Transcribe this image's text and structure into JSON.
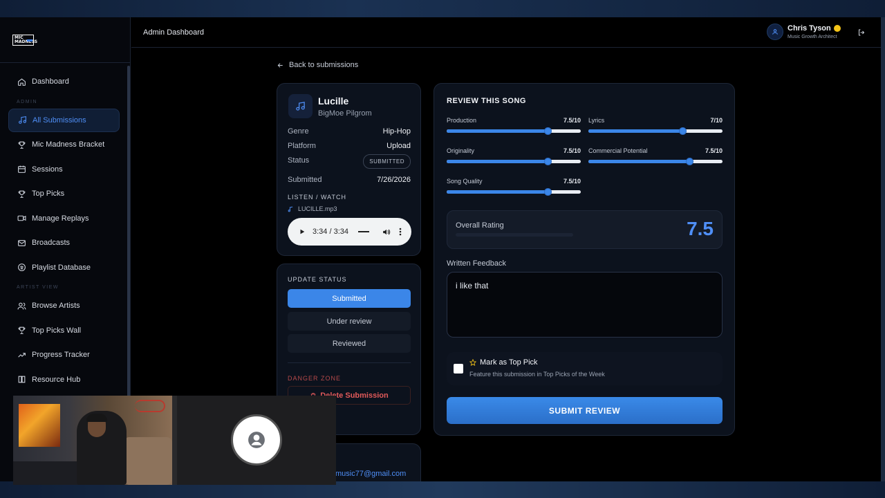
{
  "header": {
    "title": "Admin Dashboard",
    "user_name": "Chris Tyson",
    "user_role": "Music Growth Architect"
  },
  "logo": {
    "line1": "MIC",
    "line2": "MADNESS"
  },
  "sidebar": {
    "admin_label": "ADMIN",
    "artist_label": "ARTIST VIEW",
    "items": [
      {
        "label": "Dashboard",
        "icon": "home-icon"
      },
      {
        "label": "All Submissions",
        "icon": "music-note-icon",
        "active": true
      },
      {
        "label": "Mic Madness Bracket",
        "icon": "trophy-icon"
      },
      {
        "label": "Sessions",
        "icon": "calendar-icon"
      },
      {
        "label": "Top Picks",
        "icon": "trophy-icon"
      },
      {
        "label": "Manage Replays",
        "icon": "video-icon"
      },
      {
        "label": "Broadcasts",
        "icon": "mail-icon"
      },
      {
        "label": "Playlist Database",
        "icon": "spotify-icon"
      },
      {
        "label": "Browse Artists",
        "icon": "users-icon"
      },
      {
        "label": "Top Picks Wall",
        "icon": "trophy-icon"
      },
      {
        "label": "Progress Tracker",
        "icon": "trend-icon"
      },
      {
        "label": "Resource Hub",
        "icon": "book-icon"
      }
    ]
  },
  "back_link": "Back to submissions",
  "song": {
    "title": "Lucille",
    "artist": "BigMoe Pilgrom",
    "genre_label": "Genre",
    "genre": "Hip-Hop",
    "platform_label": "Platform",
    "platform": "Upload",
    "status_label": "Status",
    "status": "SUBMITTED",
    "submitted_label": "Submitted",
    "submitted": "7/26/2026",
    "listen_label": "LISTEN / WATCH",
    "file_name": "LUCILLE.mp3",
    "audio_time": "3:34 / 3:34"
  },
  "update_status": {
    "label": "UPDATE STATUS",
    "options": [
      "Submitted",
      "Under review",
      "Reviewed"
    ],
    "selected": "Submitted",
    "danger_label": "DANGER ZONE",
    "delete_label": "Delete Submission"
  },
  "contact": {
    "email": "music77@gmail.com"
  },
  "review": {
    "title": "REVIEW THIS SONG",
    "criteria": [
      {
        "label": "Production",
        "value": "7.5/10",
        "level": 0.75
      },
      {
        "label": "Lyrics",
        "value": "7/10",
        "level": 0.7
      },
      {
        "label": "Originality",
        "value": "7.5/10",
        "level": 0.75
      },
      {
        "label": "Commercial Potential",
        "value": "7.5/10",
        "level": 0.75
      },
      {
        "label": "Song Quality",
        "value": "7.5/10",
        "level": 0.75
      }
    ],
    "overall_label": "Overall Rating",
    "overall_value": "7.5",
    "feedback_label": "Written Feedback",
    "feedback_text": "i like that",
    "top_pick_label": "Mark as Top Pick",
    "top_pick_desc": "Feature this submission in Top Picks of the Week",
    "submit_label": "SUBMIT REVIEW"
  },
  "colors": {
    "accent": "#3b86e8",
    "danger": "#e35a5a",
    "bg": "#000000"
  }
}
